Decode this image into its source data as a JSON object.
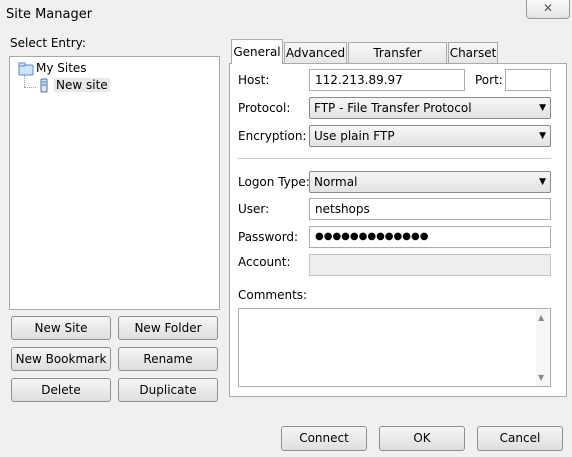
{
  "window": {
    "title": "Site Manager",
    "close_glyph": "✕"
  },
  "left": {
    "select_entry_label": "Select Entry:",
    "tree": {
      "root": "My Sites",
      "child": "New site"
    },
    "buttons": {
      "new_site": "New Site",
      "new_folder": "New Folder",
      "new_bookmark": "New Bookmark",
      "rename": "Rename",
      "delete": "Delete",
      "duplicate": "Duplicate"
    }
  },
  "tabs": [
    "General",
    "Advanced",
    "Transfer Settings",
    "Charset"
  ],
  "general": {
    "host_label": "Host:",
    "host_value": "112.213.89.97",
    "port_label": "Port:",
    "port_value": "",
    "protocol_label": "Protocol:",
    "protocol_value": "FTP - File Transfer Protocol",
    "encryption_label": "Encryption:",
    "encryption_value": "Use plain FTP",
    "logon_type_label": "Logon Type:",
    "logon_type_value": "Normal",
    "user_label": "User:",
    "user_value": "netshops",
    "password_label": "Password:",
    "password_value": "●●●●●●●●●●●●●",
    "account_label": "Account:",
    "account_value": "",
    "comments_label": "Comments:"
  },
  "footer": {
    "connect": "Connect",
    "ok": "OK",
    "cancel": "Cancel"
  }
}
